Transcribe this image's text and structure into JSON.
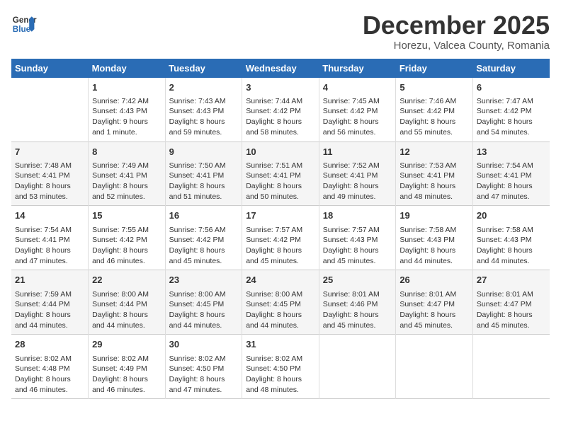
{
  "header": {
    "logo_line1": "General",
    "logo_line2": "Blue",
    "month": "December 2025",
    "location": "Horezu, Valcea County, Romania"
  },
  "weekdays": [
    "Sunday",
    "Monday",
    "Tuesday",
    "Wednesday",
    "Thursday",
    "Friday",
    "Saturday"
  ],
  "weeks": [
    [
      {
        "day": "",
        "info": ""
      },
      {
        "day": "1",
        "info": "Sunrise: 7:42 AM\nSunset: 4:43 PM\nDaylight: 9 hours\nand 1 minute."
      },
      {
        "day": "2",
        "info": "Sunrise: 7:43 AM\nSunset: 4:43 PM\nDaylight: 8 hours\nand 59 minutes."
      },
      {
        "day": "3",
        "info": "Sunrise: 7:44 AM\nSunset: 4:42 PM\nDaylight: 8 hours\nand 58 minutes."
      },
      {
        "day": "4",
        "info": "Sunrise: 7:45 AM\nSunset: 4:42 PM\nDaylight: 8 hours\nand 56 minutes."
      },
      {
        "day": "5",
        "info": "Sunrise: 7:46 AM\nSunset: 4:42 PM\nDaylight: 8 hours\nand 55 minutes."
      },
      {
        "day": "6",
        "info": "Sunrise: 7:47 AM\nSunset: 4:42 PM\nDaylight: 8 hours\nand 54 minutes."
      }
    ],
    [
      {
        "day": "7",
        "info": "Sunrise: 7:48 AM\nSunset: 4:41 PM\nDaylight: 8 hours\nand 53 minutes."
      },
      {
        "day": "8",
        "info": "Sunrise: 7:49 AM\nSunset: 4:41 PM\nDaylight: 8 hours\nand 52 minutes."
      },
      {
        "day": "9",
        "info": "Sunrise: 7:50 AM\nSunset: 4:41 PM\nDaylight: 8 hours\nand 51 minutes."
      },
      {
        "day": "10",
        "info": "Sunrise: 7:51 AM\nSunset: 4:41 PM\nDaylight: 8 hours\nand 50 minutes."
      },
      {
        "day": "11",
        "info": "Sunrise: 7:52 AM\nSunset: 4:41 PM\nDaylight: 8 hours\nand 49 minutes."
      },
      {
        "day": "12",
        "info": "Sunrise: 7:53 AM\nSunset: 4:41 PM\nDaylight: 8 hours\nand 48 minutes."
      },
      {
        "day": "13",
        "info": "Sunrise: 7:54 AM\nSunset: 4:41 PM\nDaylight: 8 hours\nand 47 minutes."
      }
    ],
    [
      {
        "day": "14",
        "info": "Sunrise: 7:54 AM\nSunset: 4:41 PM\nDaylight: 8 hours\nand 47 minutes."
      },
      {
        "day": "15",
        "info": "Sunrise: 7:55 AM\nSunset: 4:42 PM\nDaylight: 8 hours\nand 46 minutes."
      },
      {
        "day": "16",
        "info": "Sunrise: 7:56 AM\nSunset: 4:42 PM\nDaylight: 8 hours\nand 45 minutes."
      },
      {
        "day": "17",
        "info": "Sunrise: 7:57 AM\nSunset: 4:42 PM\nDaylight: 8 hours\nand 45 minutes."
      },
      {
        "day": "18",
        "info": "Sunrise: 7:57 AM\nSunset: 4:43 PM\nDaylight: 8 hours\nand 45 minutes."
      },
      {
        "day": "19",
        "info": "Sunrise: 7:58 AM\nSunset: 4:43 PM\nDaylight: 8 hours\nand 44 minutes."
      },
      {
        "day": "20",
        "info": "Sunrise: 7:58 AM\nSunset: 4:43 PM\nDaylight: 8 hours\nand 44 minutes."
      }
    ],
    [
      {
        "day": "21",
        "info": "Sunrise: 7:59 AM\nSunset: 4:44 PM\nDaylight: 8 hours\nand 44 minutes."
      },
      {
        "day": "22",
        "info": "Sunrise: 8:00 AM\nSunset: 4:44 PM\nDaylight: 8 hours\nand 44 minutes."
      },
      {
        "day": "23",
        "info": "Sunrise: 8:00 AM\nSunset: 4:45 PM\nDaylight: 8 hours\nand 44 minutes."
      },
      {
        "day": "24",
        "info": "Sunrise: 8:00 AM\nSunset: 4:45 PM\nDaylight: 8 hours\nand 44 minutes."
      },
      {
        "day": "25",
        "info": "Sunrise: 8:01 AM\nSunset: 4:46 PM\nDaylight: 8 hours\nand 45 minutes."
      },
      {
        "day": "26",
        "info": "Sunrise: 8:01 AM\nSunset: 4:47 PM\nDaylight: 8 hours\nand 45 minutes."
      },
      {
        "day": "27",
        "info": "Sunrise: 8:01 AM\nSunset: 4:47 PM\nDaylight: 8 hours\nand 45 minutes."
      }
    ],
    [
      {
        "day": "28",
        "info": "Sunrise: 8:02 AM\nSunset: 4:48 PM\nDaylight: 8 hours\nand 46 minutes."
      },
      {
        "day": "29",
        "info": "Sunrise: 8:02 AM\nSunset: 4:49 PM\nDaylight: 8 hours\nand 46 minutes."
      },
      {
        "day": "30",
        "info": "Sunrise: 8:02 AM\nSunset: 4:50 PM\nDaylight: 8 hours\nand 47 minutes."
      },
      {
        "day": "31",
        "info": "Sunrise: 8:02 AM\nSunset: 4:50 PM\nDaylight: 8 hours\nand 48 minutes."
      },
      {
        "day": "",
        "info": ""
      },
      {
        "day": "",
        "info": ""
      },
      {
        "day": "",
        "info": ""
      }
    ]
  ]
}
